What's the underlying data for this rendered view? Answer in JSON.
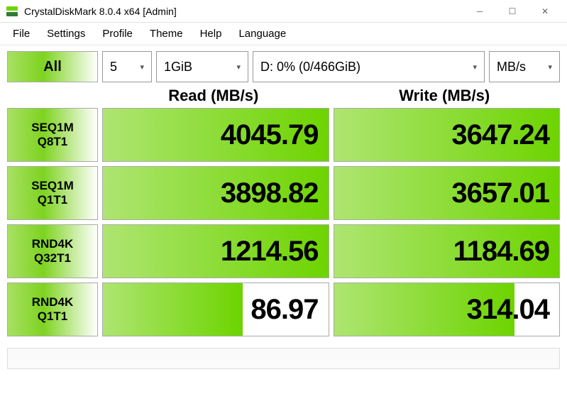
{
  "window": {
    "title": "CrystalDiskMark 8.0.4 x64 [Admin]",
    "icon_colors": {
      "top": "#6dd400",
      "bottom": "#2e7d32"
    }
  },
  "menu": [
    "File",
    "Settings",
    "Profile",
    "Theme",
    "Help",
    "Language"
  ],
  "toolbar": {
    "all_label": "All",
    "runs": "5",
    "size": "1GiB",
    "drive": "D: 0% (0/466GiB)",
    "unit": "MB/s"
  },
  "headers": {
    "read": "Read (MB/s)",
    "write": "Write (MB/s)"
  },
  "rows": [
    {
      "line1": "SEQ1M",
      "line2": "Q8T1",
      "read": "4045.79",
      "read_fill": 100,
      "write": "3647.24",
      "write_fill": 100
    },
    {
      "line1": "SEQ1M",
      "line2": "Q1T1",
      "read": "3898.82",
      "read_fill": 100,
      "write": "3657.01",
      "write_fill": 100
    },
    {
      "line1": "RND4K",
      "line2": "Q32T1",
      "read": "1214.56",
      "read_fill": 100,
      "write": "1184.69",
      "write_fill": 100
    },
    {
      "line1": "RND4K",
      "line2": "Q1T1",
      "read": "86.97",
      "read_fill": 62,
      "write": "314.04",
      "write_fill": 80
    }
  ]
}
